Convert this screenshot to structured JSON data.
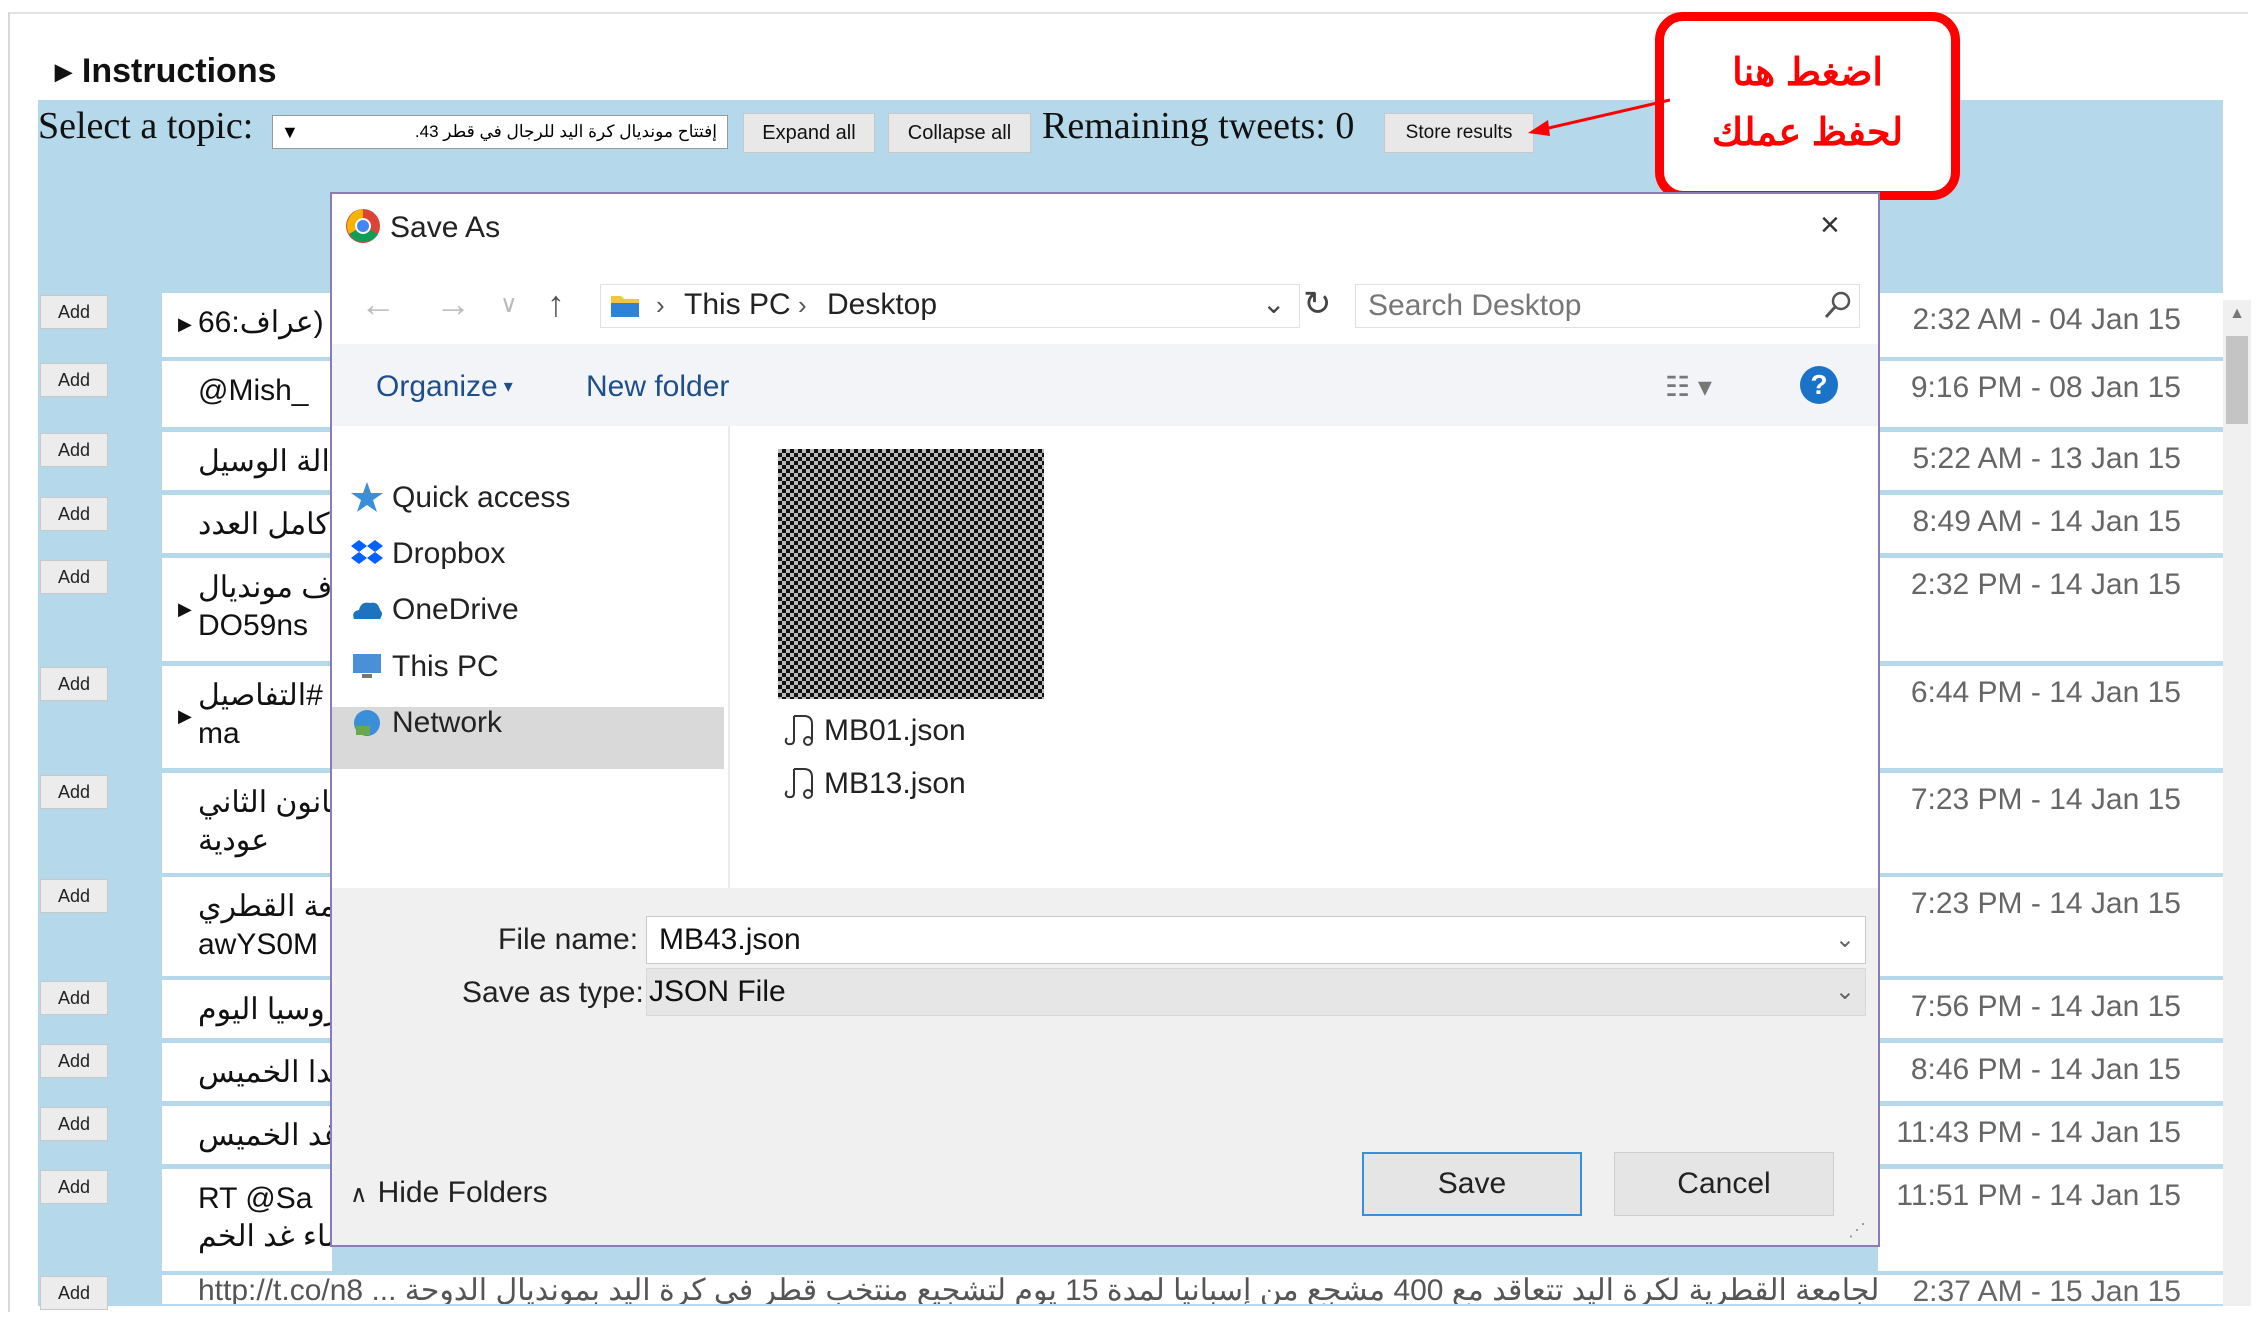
{
  "page": {
    "instructions_label": "Instructions",
    "topic_label": "Select a topic:",
    "topic_value": "إفتتاح مونديال كرة اليد للرجال في قطر 43.",
    "expand_label": "Expand all",
    "collapse_label": "Collapse all",
    "remaining_label": "Remaining tweets: 0",
    "store_label": "Store results"
  },
  "callout": {
    "line1": "اضغط هنا",
    "line2": "لحفظ عملك",
    "color": "#ff0000"
  },
  "tweets": [
    {
      "add": "Add",
      "text": "عراف:66)",
      "date": "2:32 AM - 04 Jan 15"
    },
    {
      "add": "Add",
      "text": "@Mish_",
      "date": "9:16 PM - 08 Jan 15"
    },
    {
      "add": "Add",
      "text": "الة الوسيل#",
      "date": "5:22 AM - 13 Jan 15"
    },
    {
      "add": "Add",
      "text": "كامل العدد",
      "date": "8:49 AM - 14 Jan 15"
    },
    {
      "add": "Add",
      "text": "ف مونديال",
      "text2": "DO59ns",
      "date": "2:32 PM - 14 Jan 15"
    },
    {
      "add": "Add",
      "text": "التفاصيل#",
      "text2": "ma",
      "date": "6:44 PM - 14 Jan 15"
    },
    {
      "add": "Add",
      "text": "كانون الثاني",
      "text2": "عودية",
      "date": "7:23 PM - 14 Jan 15"
    },
    {
      "add": "Add",
      "text": "مة القطري",
      "text2": "awYS0M",
      "date": "7:23 PM - 14 Jan 15"
    },
    {
      "add": "Add",
      "text": "روسيا اليوم",
      "date": "7:56 PM - 14 Jan 15"
    },
    {
      "add": "Add",
      "text": "غدا الخميس",
      "date": "8:46 PM - 14 Jan 15"
    },
    {
      "add": "Add",
      "text": "غد الخميس",
      "date": "11:43 PM - 14 Jan 15"
    },
    {
      "add": "Add",
      "text": "RT @Sa",
      "text2": "ساء غد الخم",
      "date": "11:51 PM - 14 Jan 15"
    },
    {
      "add": "Add",
      "text": "الجامعة القطرية لكرة اليد تتعاقد مع 400 مشجع من إسبانيا لمدة 15 يوم لتشجيع منتخب قطر في كرة اليد بمونديال الدوحة ... http://t.co/n8",
      "date": "2:37 AM - 15 Jan 15"
    }
  ],
  "dialog": {
    "title": "Save As",
    "close": "×",
    "nav_back": "←",
    "nav_forward": "→",
    "nav_recent": "∨",
    "nav_up": "↑",
    "breadcrumb": [
      "This PC",
      "Desktop"
    ],
    "search_placeholder": "Search Desktop",
    "organize": "Organize",
    "new_folder": "New folder",
    "help": "?",
    "nav_items": [
      "Quick access",
      "Dropbox",
      "OneDrive",
      "This PC",
      "Network"
    ],
    "selected_nav": "This PC",
    "files": [
      "MB01.json",
      "MB13.json"
    ],
    "file_name_label": "File name:",
    "file_name_value": "MB43.json",
    "save_type_label": "Save as type:",
    "save_type_value": "JSON File",
    "hide_folders": "Hide Folders",
    "save": "Save",
    "cancel": "Cancel"
  },
  "colors": {
    "background_blue": "#b5d9ea",
    "dialog_border": "#8c7bb4",
    "accent_blue": "#3b8fd9",
    "link_blue": "#1f4f8a"
  }
}
